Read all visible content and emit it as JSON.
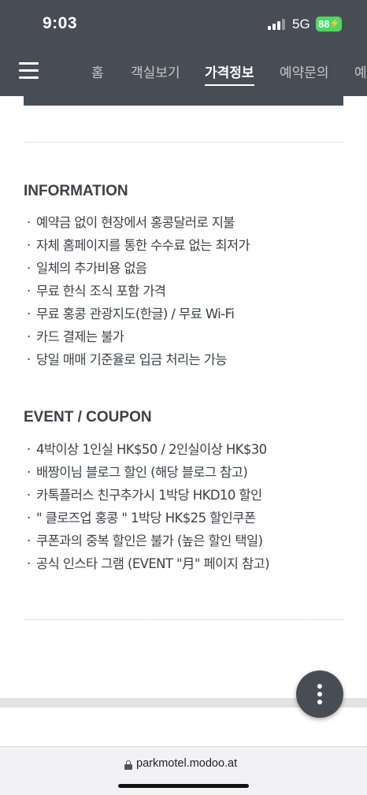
{
  "status_bar": {
    "time": "9:03",
    "network": "5G",
    "battery": "88",
    "battery_icon": "charging-bolt-icon"
  },
  "nav": {
    "menu_icon": "hamburger-menu-icon",
    "tabs": [
      {
        "label": "홈"
      },
      {
        "label": "객실보기"
      },
      {
        "label": "가격정보",
        "active": true
      },
      {
        "label": "예약문의"
      },
      {
        "label": "예"
      }
    ]
  },
  "information": {
    "title": "INFORMATION",
    "items": [
      "예약금 없이 현장에서 홍콩달러로 지불",
      "자체 홈페이지를 통한 수수료 없는 최저가",
      "일체의 추가비용 없음",
      "무료 한식 조식 포함 가격",
      "무료 홍콩 관광지도(한글) / 무료 Wi-Fi",
      "카드 결제는 불가",
      "당일 매매 기준율로 입금 처리는 가능"
    ]
  },
  "event": {
    "title": "EVENT / COUPON",
    "items": [
      "4박이상 1인실 HK$50 / 2인실이상 HK$30",
      "배짱이님 블로그 할인 (해당 블로그 참고)",
      "카톡플러스 친구추가시 1박당 HKD10 할인",
      "\" 클로즈업 홍콩 \" 1박당 HK$25 할인쿠폰",
      "쿠폰과의 중복 할인은 불가 (높은 할인 택일)",
      "공식 인스타 그램 (EVENT \"月\" 페이지 참고)"
    ]
  },
  "bullet": "·",
  "fab_icon": "more-vertical-icon",
  "browser": {
    "url": "parkmotel.modoo.at",
    "lock_icon": "lock-icon"
  },
  "colors": {
    "header_bg": "#484d55",
    "battery_green": "#4cd964",
    "text": "#3d4048"
  }
}
